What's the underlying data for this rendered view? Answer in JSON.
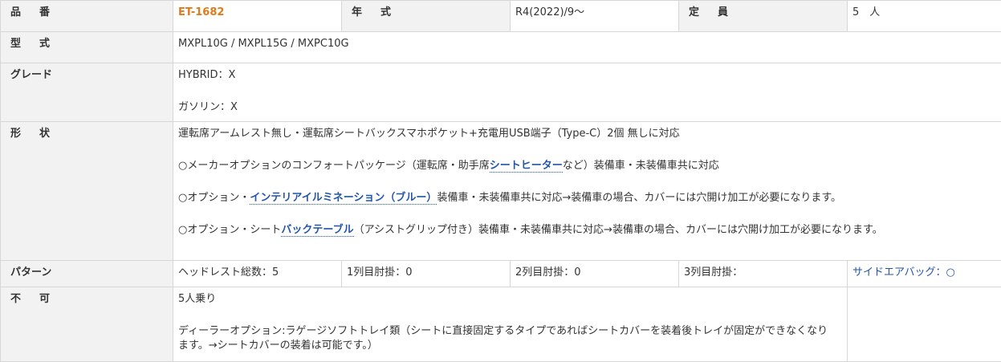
{
  "hinban": {
    "label_a": "品",
    "label_b": "番",
    "value": "ET-1682"
  },
  "nenshiki": {
    "label_a": "年",
    "label_b": "式",
    "value": "R4(2022)/9～"
  },
  "teiin": {
    "label_a": "定",
    "label_b": "員",
    "value": "5　人"
  },
  "katashiki": {
    "label_a": "型",
    "label_b": "式",
    "value": "MXPL10G / MXPL15G / MXPC10G"
  },
  "grade": {
    "label": "グレード",
    "lines": [
      "HYBRID：X",
      "ガソリン：X"
    ]
  },
  "keijou": {
    "label_a": "形",
    "label_b": "状",
    "line1": "運転席アームレスト無し・運転席シートバックスマホポケット+充電用USB端子（Type-C）2個 無しに対応",
    "line2_pre": "○メーカーオプションのコンフォートパッケージ（運転席・助手席",
    "line2_kw": "シートヒーター",
    "line2_post": "など）装備車・未装備車共に対応",
    "line3_pre": "○オプション・",
    "line3_kw": "インテリアイルミネーション（ブルー）",
    "line3_post": "装備車・未装備車共に対応→装備車の場合、カバーには穴開け加工が必要になります。",
    "line4_pre": "○オプション・シート",
    "line4_kw": "バックテーブル",
    "line4_post": "（アシストグリップ付き）装備車・未装備車共に対応→装備車の場合、カバーには穴開け加工が必要になります。"
  },
  "pattern": {
    "label": "パターン",
    "headrest": "ヘッドレスト総数：5",
    "row1": "1列目肘掛：0",
    "row2": "2列目肘掛：0",
    "row3": "3列目肘掛：",
    "airbag": "サイドエアバッグ：○"
  },
  "fuka": {
    "label_a": "不",
    "label_b": "可",
    "line1": "5人乗り",
    "line2": "ディーラーオプション:ラゲージソフトトレイ類（シートに直接固定するタイプであればシートカバーを装着後トレイが固定ができなくなります。→シートカバーの装着は可能です。）"
  }
}
